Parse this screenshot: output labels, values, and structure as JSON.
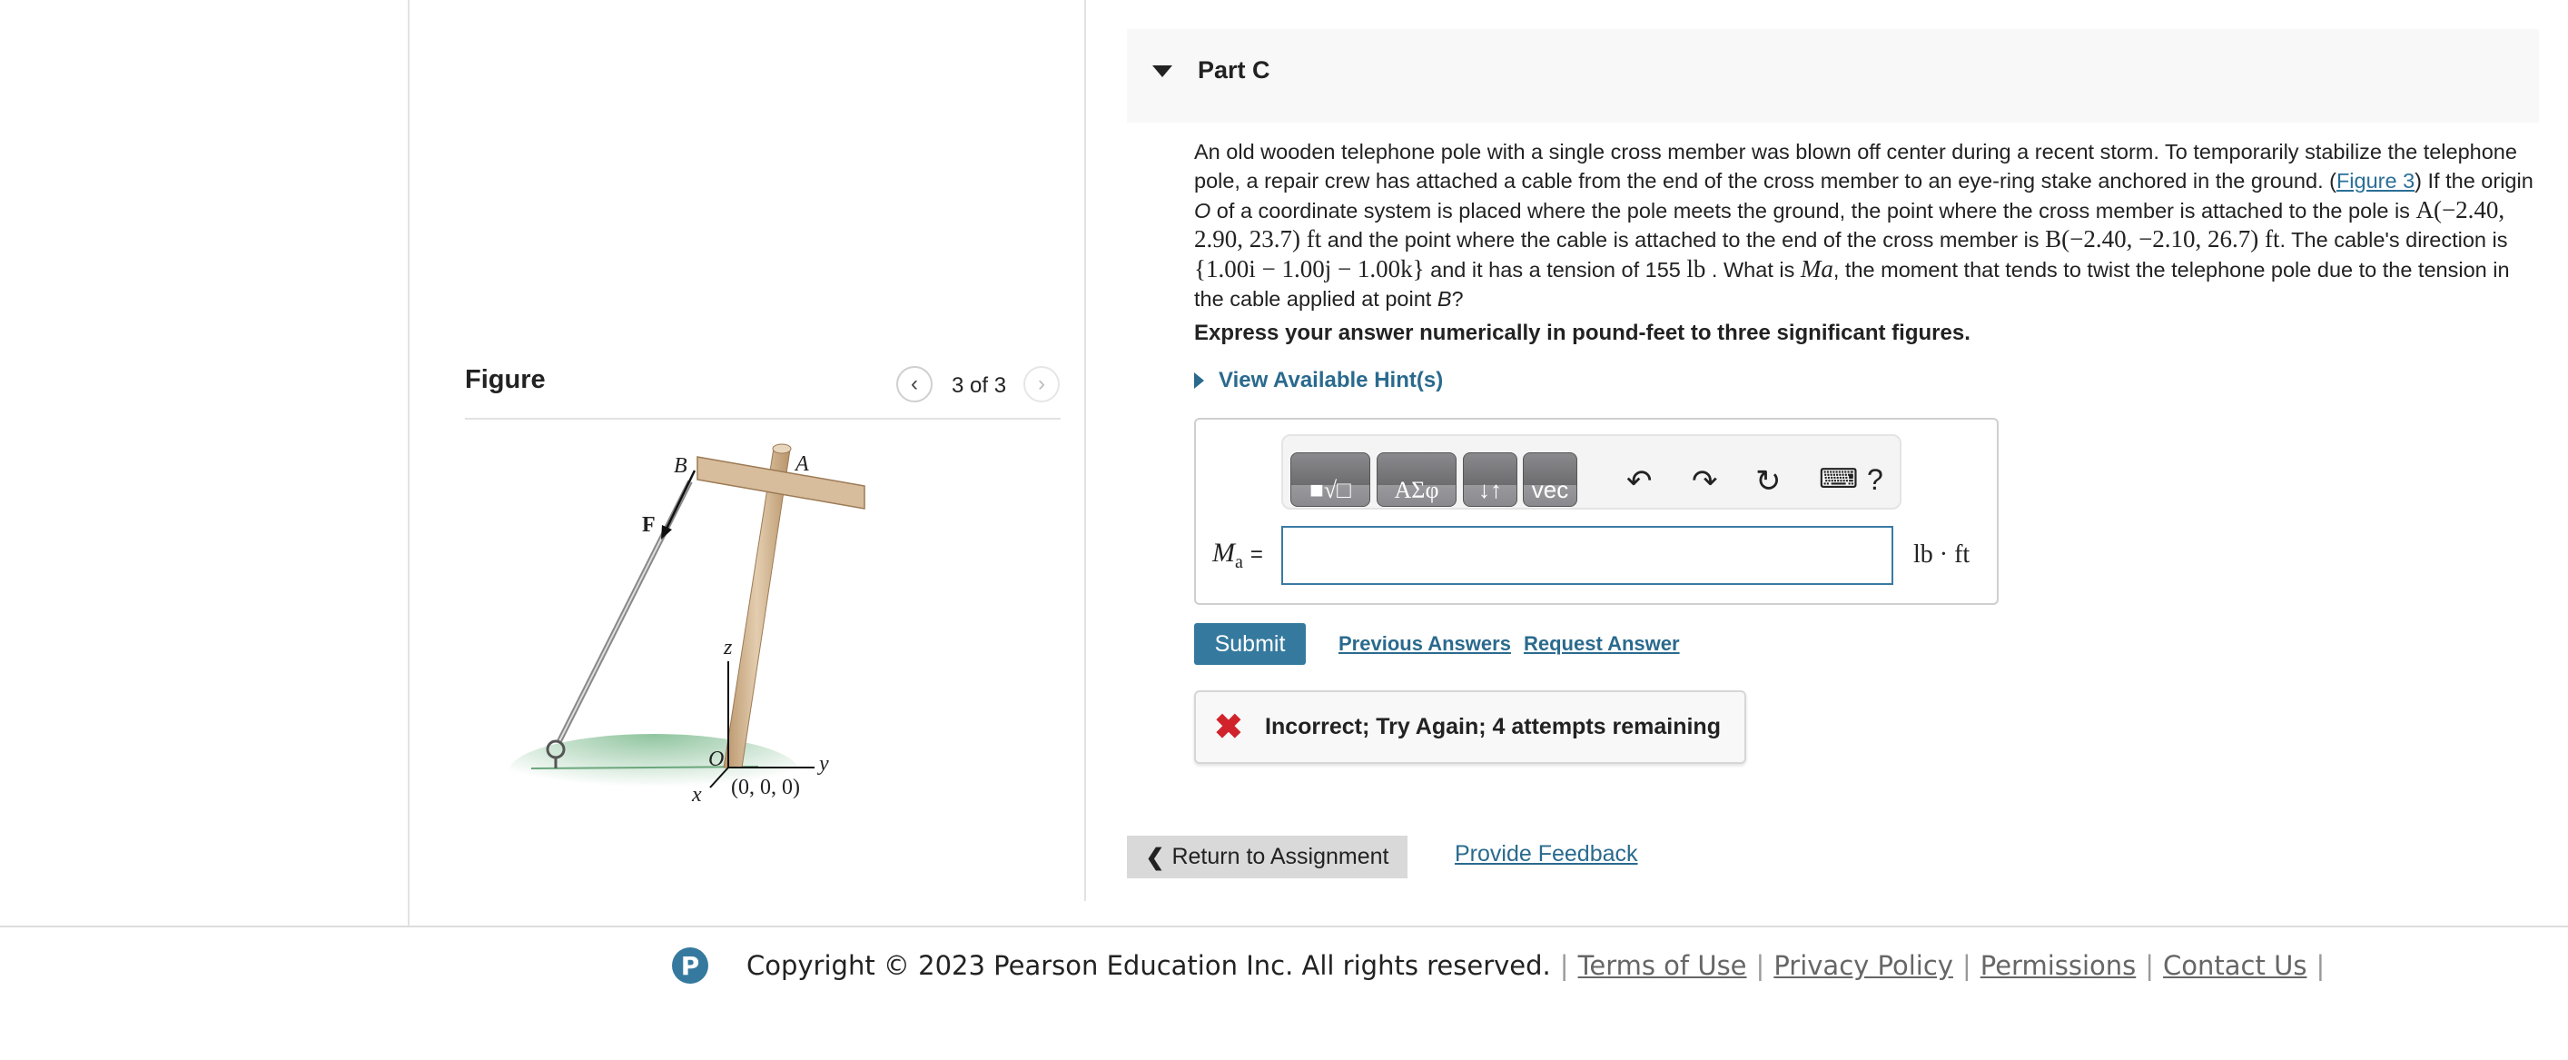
{
  "part": {
    "title": "Part C",
    "expanded_icon": "caret-down-icon"
  },
  "problem": {
    "t1": "An old wooden telephone pole with a single cross member was blown off center during a recent storm. To temporarily stabilize the telephone pole, a repair crew has attached a cable from the end of the cross member to an eye-ring stake anchored in the ground. (",
    "figure_link": "Figure 3",
    "t2": ") If the origin ",
    "O": "O",
    "t3": " of a coordinate system is placed where the pole meets the ground, the point where the cross member is attached to the pole is ",
    "A_coord": "A(−2.40, 2.90, 23.7) ft",
    "t4": " and the point where the cable is attached to the end of the cross member is ",
    "B_coord": "B(−2.40, −2.10, 26.7) ft",
    "t5": ". The cable's direction is ",
    "direction": "{1.00i − 1.00j − 1.00k}",
    "t6": " and it has a tension of 155 ",
    "lb": "lb",
    "t7": " . What is ",
    "Ma": "Ma",
    "t8": ", the moment that tends to twist the telephone pole due to the tension in the cable applied at point ",
    "B": "B",
    "t9": "?"
  },
  "instructions": "Express your answer numerically in pound-feet to three significant figures.",
  "hints_label": "View Available Hint(s)",
  "toolbar": {
    "buttons": [
      "templates",
      "ΑΣφ",
      "symbols",
      "vec"
    ],
    "icons": [
      "undo-icon",
      "redo-icon",
      "reset-icon",
      "keyboard-icon",
      "help-icon"
    ],
    "help": "?"
  },
  "answer": {
    "label_main": "M",
    "label_sub": "a",
    "equals": "=",
    "value": "",
    "units": "lb · ft"
  },
  "actions": {
    "submit": "Submit",
    "previous": "Previous Answers",
    "request": "Request Answer"
  },
  "feedback": {
    "message": "Incorrect; Try Again; 4 attempts remaining",
    "status_color": "#d0232b"
  },
  "nav": {
    "return": "Return to Assignment",
    "feedback": "Provide Feedback"
  },
  "figure": {
    "heading": "Figure",
    "pager": "3 of 3",
    "labels": {
      "B": "B",
      "A": "A",
      "F": "F",
      "z": "z",
      "O": "O",
      "y": "y",
      "x": "x",
      "origin": "(0, 0, 0)"
    }
  },
  "footer": {
    "logo": "P",
    "copyright": "Copyright © 2023  Pearson Education Inc. All rights reserved.",
    "links": [
      "Terms of Use",
      "Privacy Policy",
      "Permissions",
      "Contact Us"
    ]
  },
  "colors": {
    "accent": "#357a9e",
    "link": "#2a6a8e",
    "error": "#d0232b"
  }
}
